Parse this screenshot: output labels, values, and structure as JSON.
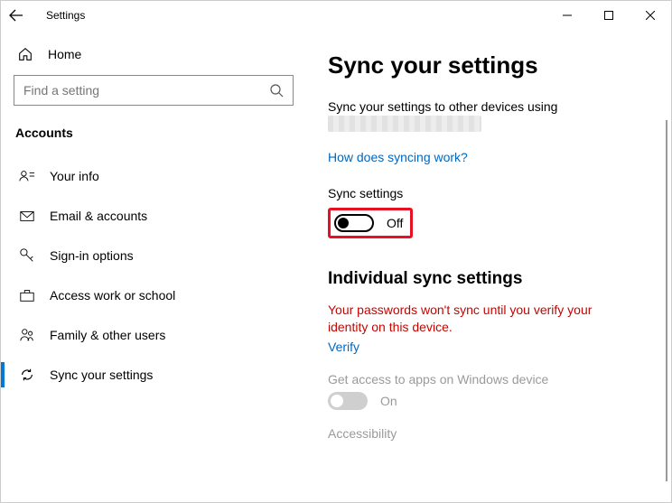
{
  "titlebar": {
    "app_title": "Settings"
  },
  "sidebar": {
    "home_label": "Home",
    "search_placeholder": "Find a setting",
    "category_label": "Accounts",
    "items": [
      {
        "label": "Your info"
      },
      {
        "label": "Email & accounts"
      },
      {
        "label": "Sign-in options"
      },
      {
        "label": "Access work or school"
      },
      {
        "label": "Family & other users"
      },
      {
        "label": "Sync your settings"
      }
    ]
  },
  "main": {
    "title": "Sync your settings",
    "description": "Sync your settings to other devices using",
    "sync_help_link": "How does syncing work?",
    "sync_settings_label": "Sync settings",
    "sync_toggle_state": "Off",
    "individual_title": "Individual sync settings",
    "warning_text": "Your passwords won't sync until you verify your identity on this device.",
    "verify_link": "Verify",
    "apps_label": "Get access to apps on Windows device",
    "apps_toggle_state": "On",
    "accessibility_label": "Accessibility"
  }
}
